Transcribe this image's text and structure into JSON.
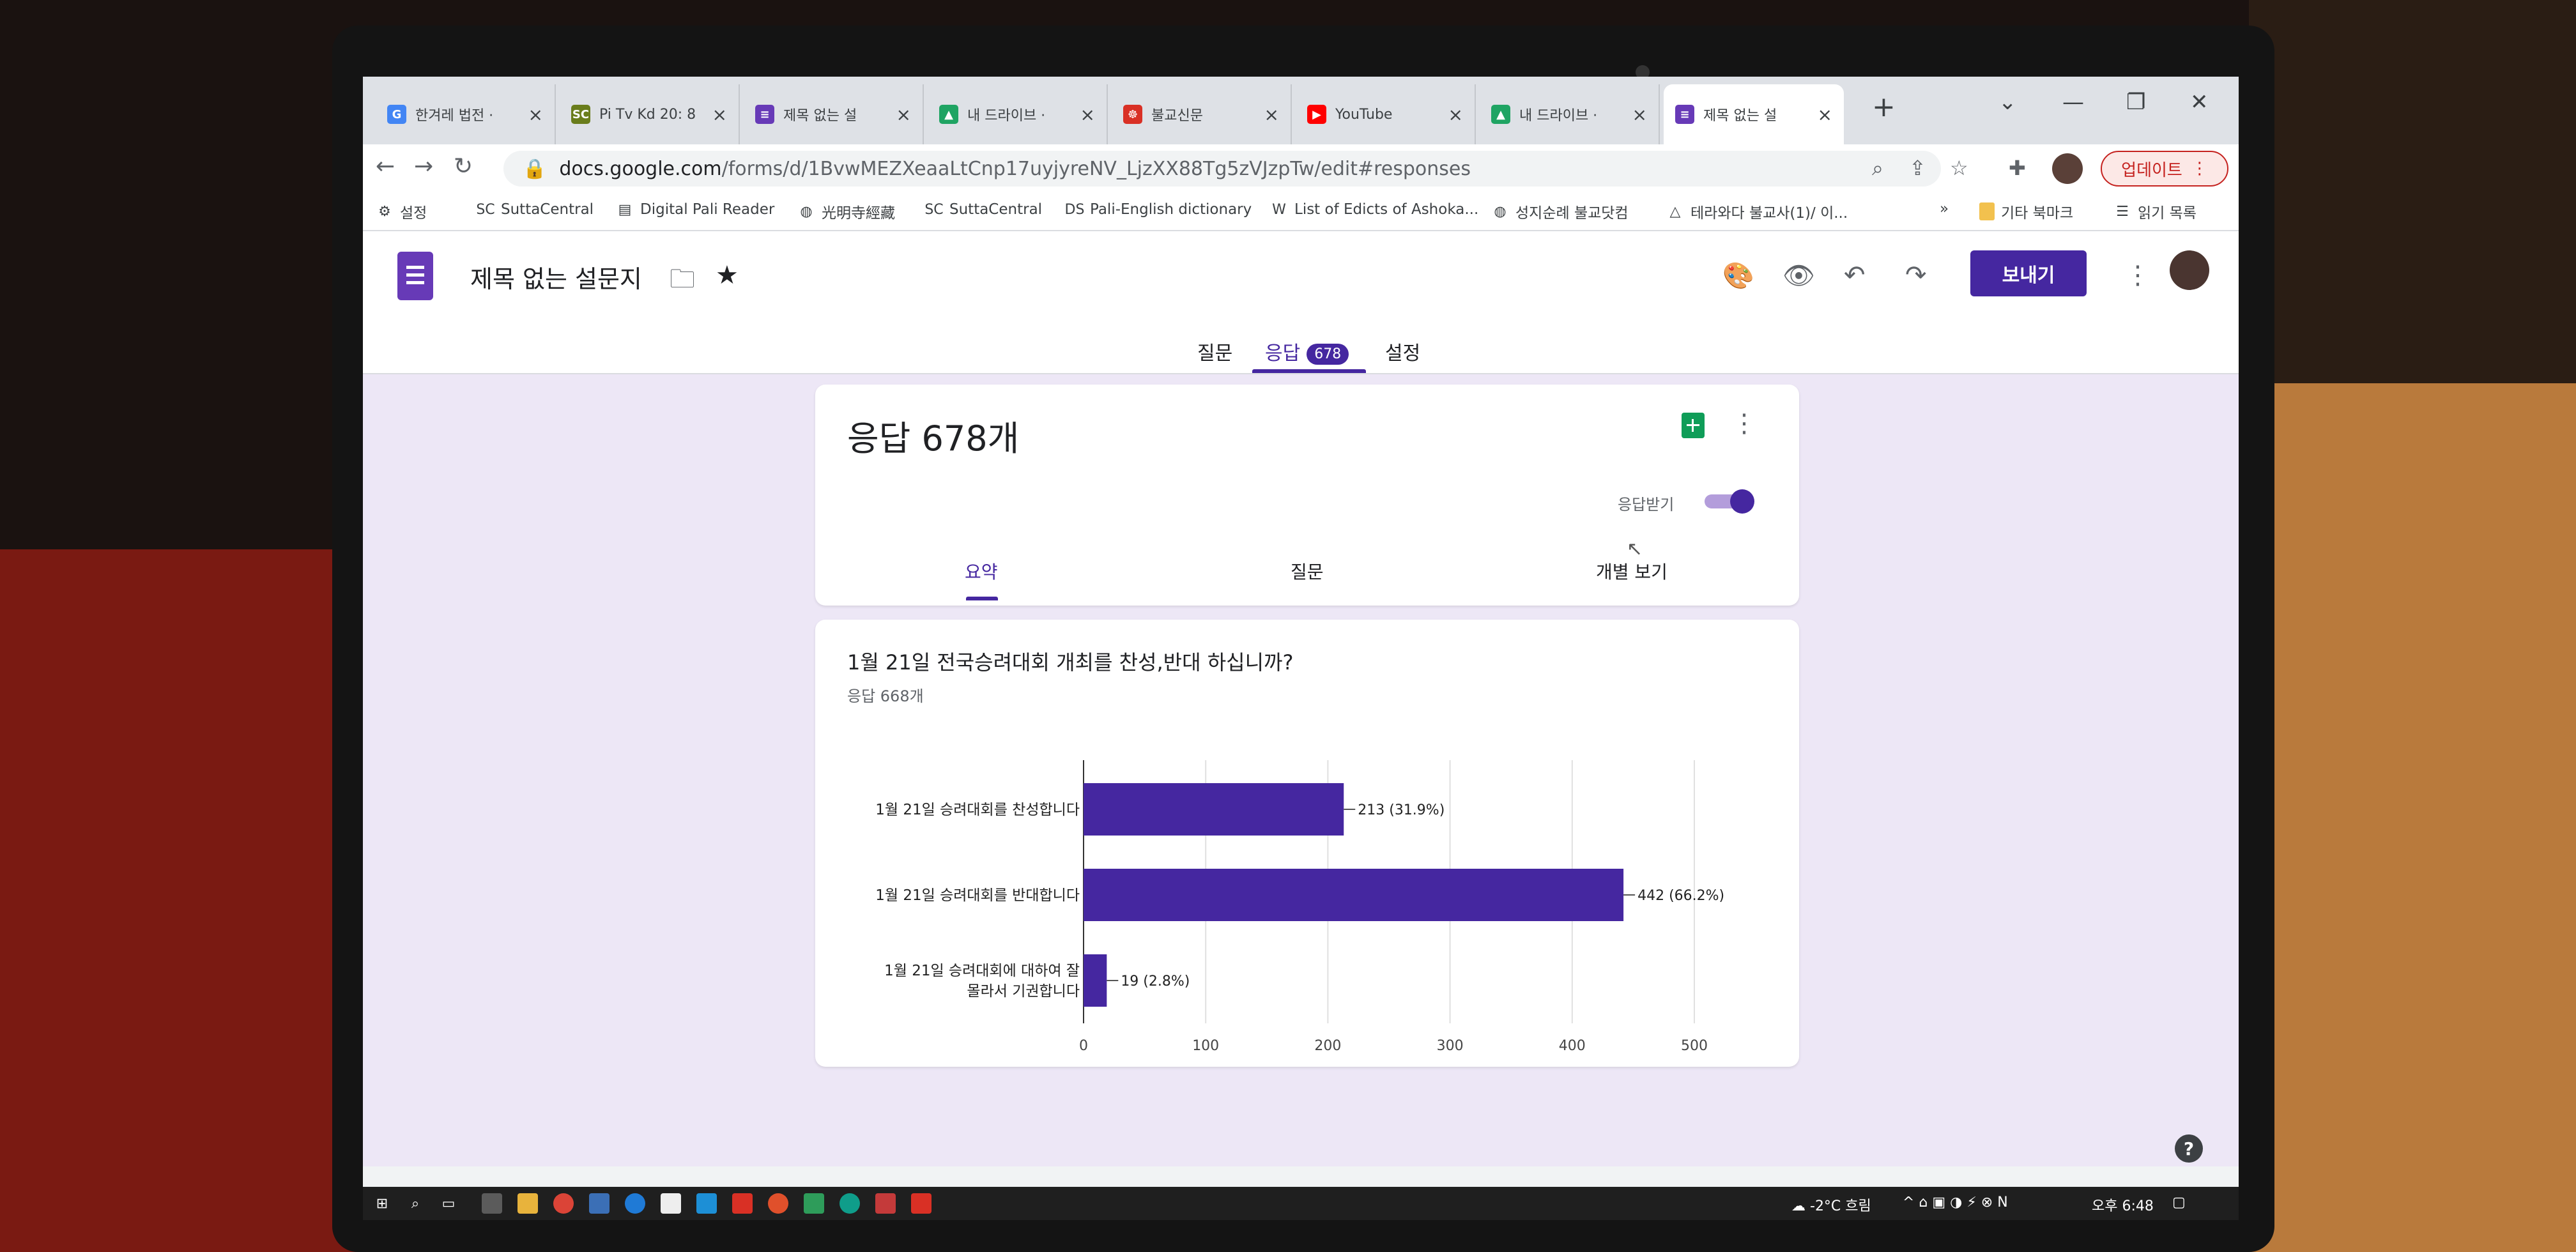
{
  "browser": {
    "tabs": [
      {
        "title": "한겨레 법전 ·",
        "favicon": "google-icon",
        "color": "#4285f4"
      },
      {
        "title": "Pi Tv Kd 20: 8",
        "favicon": "suttacentral-icon",
        "color": "#6a7d1c"
      },
      {
        "title": "제목 없는 설",
        "favicon": "forms-icon",
        "color": "#673ab7"
      },
      {
        "title": "내 드라이브 ·",
        "favicon": "drive-icon",
        "color": "#1fa463"
      },
      {
        "title": "불교신문",
        "favicon": "news-icon",
        "color": "#d93025"
      },
      {
        "title": "YouTube",
        "favicon": "youtube-icon",
        "color": "#ff0000"
      },
      {
        "title": "내 드라이브 ·",
        "favicon": "drive-icon",
        "color": "#1fa463"
      },
      {
        "title": "제목 없는 설",
        "favicon": "forms-icon",
        "color": "#673ab7"
      }
    ],
    "url_main": "docs.google.com",
    "url_rest": "/forms/d/1BvwMEZXeaaLtCnp17uyjyreNV_LjzXX88Tg5zVJzpTw/edit#responses",
    "update_label": "업데이트",
    "bookmarks": [
      {
        "label": "설정",
        "icon": "gear-icon"
      },
      {
        "label": "SuttaCentral",
        "icon": "suttacentral-icon"
      },
      {
        "label": "Digital Pali Reader",
        "icon": "book-icon"
      },
      {
        "label": "光明寺經藏",
        "icon": "globe-icon"
      },
      {
        "label": "SuttaCentral",
        "icon": "suttacentral-icon"
      },
      {
        "label": "Pali-English dictionary",
        "icon": "dsal-icon"
      },
      {
        "label": "List of Edicts of Ashoka...",
        "icon": "wikipedia-icon"
      },
      {
        "label": "성지순례 불교닷컴",
        "icon": "globe-icon"
      },
      {
        "label": "테라와다 불교사(1)/ 이...",
        "icon": "triangle-icon"
      }
    ],
    "other_bookmarks": "기타 북마크",
    "reading_list": "읽기 목록"
  },
  "form": {
    "title": "제목 없는 설문지",
    "send_label": "보내기",
    "tabs": {
      "questions": "질문",
      "responses": "응답",
      "responses_badge": "678",
      "settings": "설정"
    }
  },
  "responses": {
    "heading": "응답 678개",
    "accepting_label": "응답받기",
    "accepting": true,
    "subtabs": {
      "summary": "요약",
      "question": "질문",
      "individual": "개별 보기"
    }
  },
  "question": {
    "title": "1월 21일 전국승려대회 개최를 찬성,반대 하십니까?",
    "count": "응답 668개"
  },
  "chart_data": {
    "type": "bar",
    "orientation": "horizontal",
    "categories": [
      [
        "1월 21일 승려대회를 찬성합니다"
      ],
      [
        "1월 21일 승려대회를 반대합니다"
      ],
      [
        "1월 21일 승려대회에 대하여 잘",
        "몰라서 기권합니다"
      ]
    ],
    "values": [
      213,
      442,
      19
    ],
    "data_labels": [
      "213 (31.9%)",
      "442 (66.2%)",
      "19 (2.8%)"
    ],
    "xlim": [
      0,
      500
    ],
    "xticks": [
      "0",
      "100",
      "200",
      "300",
      "400",
      "500"
    ],
    "bar_color": "#4527a0",
    "grid": true
  },
  "taskbar": {
    "weather": "-2°C 흐림",
    "time": "오후 6:48"
  }
}
